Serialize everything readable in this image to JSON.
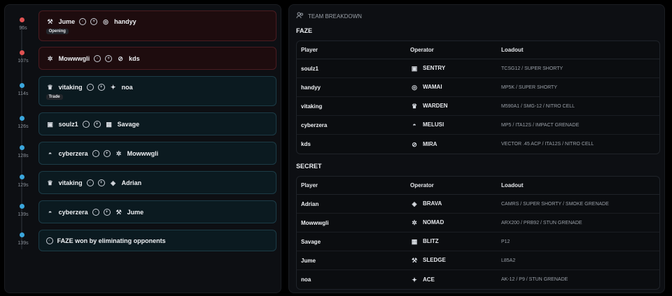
{
  "timeline": {
    "events": [
      {
        "time": "96s",
        "color": "red",
        "killer": "Jume",
        "killer_icon": "sledge-icon",
        "victim": "handyy",
        "victim_icon": "wamai-icon",
        "tag": "Opening"
      },
      {
        "time": "107s",
        "color": "red",
        "killer": "Mowwwgli",
        "killer_icon": "nomad-icon",
        "victim": "kds",
        "victim_icon": "mira-icon",
        "tag": ""
      },
      {
        "time": "114s",
        "color": "blue",
        "killer": "vitaking",
        "killer_icon": "warden-icon",
        "victim": "noa",
        "victim_icon": "ace-icon",
        "tag": "Trade"
      },
      {
        "time": "126s",
        "color": "blue",
        "killer": "soulz1",
        "killer_icon": "sentry-icon",
        "victim": "Savage",
        "victim_icon": "blitz-icon",
        "tag": ""
      },
      {
        "time": "128s",
        "color": "blue",
        "killer": "cyberzera",
        "killer_icon": "melusi-icon",
        "victim": "Mowwwgli",
        "victim_icon": "nomad-icon",
        "tag": ""
      },
      {
        "time": "129s",
        "color": "blue",
        "killer": "vitaking",
        "killer_icon": "warden-icon",
        "victim": "Adrian",
        "victim_icon": "brava-icon",
        "tag": ""
      },
      {
        "time": "139s",
        "color": "blue",
        "killer": "cyberzera",
        "killer_icon": "melusi-icon",
        "victim": "Jume",
        "victim_icon": "sledge-icon",
        "tag": ""
      }
    ],
    "final": {
      "time": "139s",
      "text": "FAZE won by eliminating opponents"
    }
  },
  "breakdown": {
    "title": "TEAM BREAKDOWN",
    "headers": {
      "player": "Player",
      "operator": "Operator",
      "loadout": "Loadout"
    },
    "teams": [
      {
        "name": "FAZE",
        "rows": [
          {
            "player": "soulz1",
            "operator": "SENTRY",
            "icon": "sentry-icon",
            "loadout": "TCSG12 / SUPER SHORTY"
          },
          {
            "player": "handyy",
            "operator": "WAMAI",
            "icon": "wamai-icon",
            "loadout": "MP5K / SUPER SHORTY"
          },
          {
            "player": "vitaking",
            "operator": "WARDEN",
            "icon": "warden-icon",
            "loadout": "M590A1 / SMG-12 / NITRO CELL"
          },
          {
            "player": "cyberzera",
            "operator": "MELUSI",
            "icon": "melusi-icon",
            "loadout": "MP5 / ITA12S / IMPACT GRENADE"
          },
          {
            "player": "kds",
            "operator": "MIRA",
            "icon": "mira-icon",
            "loadout": "VECTOR .45 ACP / ITA12S / NITRO CELL"
          }
        ]
      },
      {
        "name": "SECRET",
        "rows": [
          {
            "player": "Adrian",
            "operator": "BRAVA",
            "icon": "brava-icon",
            "loadout": "CAMRS / SUPER SHORTY / SMOKE GRENADE"
          },
          {
            "player": "Mowwwgli",
            "operator": "NOMAD",
            "icon": "nomad-icon",
            "loadout": "ARX200 / PRB92 / STUN GRENADE"
          },
          {
            "player": "Savage",
            "operator": "BLITZ",
            "icon": "blitz-icon",
            "loadout": "P12"
          },
          {
            "player": "Jume",
            "operator": "SLEDGE",
            "icon": "sledge-icon",
            "loadout": "L85A2"
          },
          {
            "player": "noa",
            "operator": "ACE",
            "icon": "ace-icon",
            "loadout": "AK-12 / P9 / STUN GRENADE"
          }
        ]
      }
    ]
  },
  "colors": {
    "red": "#e05252",
    "blue": "#3aa6dc"
  }
}
